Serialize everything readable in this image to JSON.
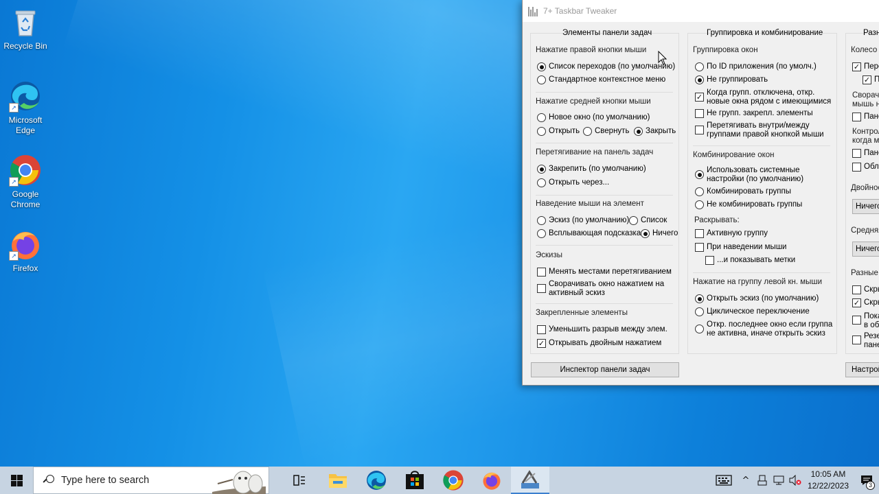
{
  "desktop": {
    "icons": [
      {
        "label": "Recycle Bin"
      },
      {
        "label": "Microsoft\nEdge"
      },
      {
        "label": "Google\nChrome"
      },
      {
        "label": "Firefox"
      }
    ]
  },
  "window": {
    "title": "7+ Taskbar Tweaker",
    "col1": {
      "header": "Элементы панели задач",
      "right_click": {
        "title": "Нажатие правой кнопки мыши",
        "opt1": "Список переходов (по умолчанию)",
        "opt2": "Стандартное контекстное меню"
      },
      "middle_click": {
        "title": "Нажатие средней кнопки мыши",
        "opt1": "Новое окно (по умолчанию)",
        "opt2": "Открыть",
        "opt3": "Свернуть",
        "opt4": "Закрыть"
      },
      "drag": {
        "title": "Перетягивание на панель задач",
        "opt1": "Закрепить (по умолчанию)",
        "opt2": "Открыть через..."
      },
      "hover": {
        "title": "Наведение мыши на элемент",
        "opt1": "Эскиз (по умолчанию)",
        "opt2": "Список",
        "opt3": "Всплывающая подсказка",
        "opt4": "Ничего"
      },
      "thumbs": {
        "title": "Эскизы",
        "opt1": "Менять местами перетягиванием",
        "opt2a": "Сворачивать окно нажатием на",
        "opt2b": "активный эскиз"
      },
      "pinned": {
        "title": "Закрепленные элементы",
        "opt1": "Уменьшить разрыв между элем.",
        "opt2": "Открывать двойным нажатием"
      },
      "inspector_button": "Инспектор панели задач"
    },
    "col2": {
      "header": "Группировка и комбинирование",
      "grouping": {
        "title": "Группировка окон",
        "opt1": "По ID приложения (по умолч.)",
        "opt2": "Не группировать",
        "opt3a": "Когда групп. отключена, откр.",
        "opt3b": "новые окна рядом с имеющимися",
        "opt4": "Не групп. закрепл. элементы",
        "opt5a": "Перетягивать внутри/между",
        "opt5b": "группами правой кнопкой мыши"
      },
      "combining": {
        "title": "Комбинирование окон",
        "opt1a": "Использовать системные",
        "opt1b": "настройки (по умолчанию)",
        "opt2": "Комбинировать группы",
        "opt3": "Не комбинировать группы"
      },
      "expand": {
        "title": "Раскрывать:",
        "opt1": "Активную группу",
        "opt2": "При наведении мыши",
        "opt3": "...и показывать метки"
      },
      "left_click": {
        "title": "Нажатие на группу левой кн. мыши",
        "opt1": "Открыть эскиз (по умолчанию)",
        "opt2": "Циклическое переключение",
        "opt3a": "Откр. последнее окно если группа",
        "opt3b": "не активна, иначе открыть эскиз"
      }
    },
    "col3": {
      "header": "Разн",
      "wheel_title": "Колесо м",
      "wheel_opt1": "Пере",
      "wheel_opt2": "Пр",
      "minimize_a": "Сворач",
      "minimize_b": "мышь на",
      "minimize_opt": "Пане",
      "control_a": "Контрол",
      "control_b": "когда м",
      "control_opt1": "Пане",
      "control_opt2": "Обла",
      "double_title": "Двойное",
      "double_select": "Ничего",
      "middle_title": "Средняя",
      "middle_select": "Ничего",
      "misc_title": "Разные",
      "misc_opt1": "Скры",
      "misc_opt2": "Скры",
      "misc_opt3a": "Пока",
      "misc_opt3b": "в обл",
      "misc_opt4a": "Резер",
      "misc_opt4b": "пане",
      "settings_button": "Настрой"
    }
  },
  "taskbar": {
    "search_placeholder": "Type here to search",
    "time": "10:05 AM",
    "date": "12/22/2023",
    "notification_count": "3"
  }
}
